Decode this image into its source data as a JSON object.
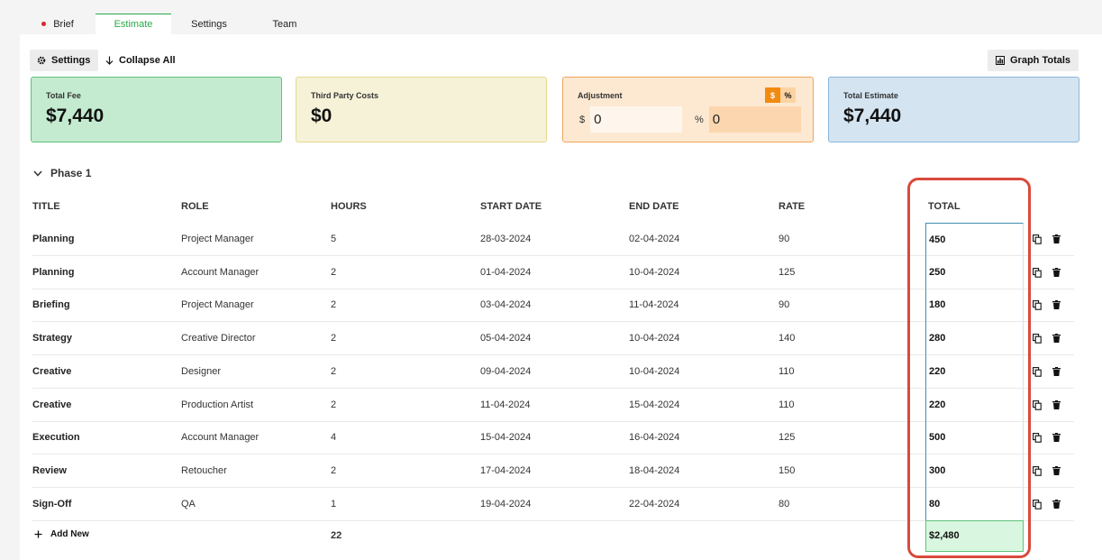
{
  "tabs": [
    {
      "label": "Brief"
    },
    {
      "label": "Estimate"
    },
    {
      "label": "Settings"
    },
    {
      "label": "Team"
    }
  ],
  "toolbar": {
    "settings_label": "Settings",
    "collapse_label": "Collapse All",
    "graph_label": "Graph Totals"
  },
  "cards": {
    "total_fee": {
      "label": "Total Fee",
      "value": "$7,440"
    },
    "third_party": {
      "label": "Third Party Costs",
      "value": "$0"
    },
    "adjustment": {
      "label": "Adjustment",
      "toggle_dollar": "$",
      "toggle_percent": "%",
      "dollar_symbol": "$",
      "dollar_value": "0",
      "percent_symbol": "%",
      "percent_value": "0"
    },
    "total_estimate": {
      "label": "Total Estimate",
      "value": "$7,440"
    }
  },
  "phase": {
    "title": "Phase 1"
  },
  "table": {
    "headers": {
      "title": "TITLE",
      "role": "ROLE",
      "hours": "HOURS",
      "start": "START DATE",
      "end": "END DATE",
      "rate": "RATE",
      "total": "TOTAL"
    },
    "rows": [
      {
        "title": "Planning",
        "role": "Project Manager",
        "hours": "5",
        "start": "28-03-2024",
        "end": "02-04-2024",
        "rate": "90",
        "total": "450"
      },
      {
        "title": "Planning",
        "role": "Account Manager",
        "hours": "2",
        "start": "01-04-2024",
        "end": "10-04-2024",
        "rate": "125",
        "total": "250"
      },
      {
        "title": "Briefing",
        "role": "Project Manager",
        "hours": "2",
        "start": "03-04-2024",
        "end": "11-04-2024",
        "rate": "90",
        "total": "180"
      },
      {
        "title": "Strategy",
        "role": "Creative Director",
        "hours": "2",
        "start": "05-04-2024",
        "end": "10-04-2024",
        "rate": "140",
        "total": "280"
      },
      {
        "title": "Creative",
        "role": "Designer",
        "hours": "2",
        "start": "09-04-2024",
        "end": "10-04-2024",
        "rate": "110",
        "total": "220"
      },
      {
        "title": "Creative",
        "role": "Production Artist",
        "hours": "2",
        "start": "11-04-2024",
        "end": "15-04-2024",
        "rate": "110",
        "total": "220"
      },
      {
        "title": "Execution",
        "role": "Account Manager",
        "hours": "4",
        "start": "15-04-2024",
        "end": "16-04-2024",
        "rate": "125",
        "total": "500"
      },
      {
        "title": "Review",
        "role": "Retoucher",
        "hours": "2",
        "start": "17-04-2024",
        "end": "18-04-2024",
        "rate": "150",
        "total": "300"
      },
      {
        "title": "Sign-Off",
        "role": "QA",
        "hours": "1",
        "start": "19-04-2024",
        "end": "22-04-2024",
        "rate": "80",
        "total": "80"
      }
    ],
    "add_new_label": "Add New",
    "hours_total": "22",
    "grand_total": "$2,480"
  },
  "colors": {
    "accent_green": "#2ba84a",
    "highlight_red": "#d94a3c",
    "adjust_orange": "#f28a0f"
  },
  "icons": [
    "gear-icon",
    "arrow-down-icon",
    "bar-chart-icon",
    "chevron-down-icon",
    "copy-icon",
    "trash-icon",
    "plus-icon"
  ]
}
